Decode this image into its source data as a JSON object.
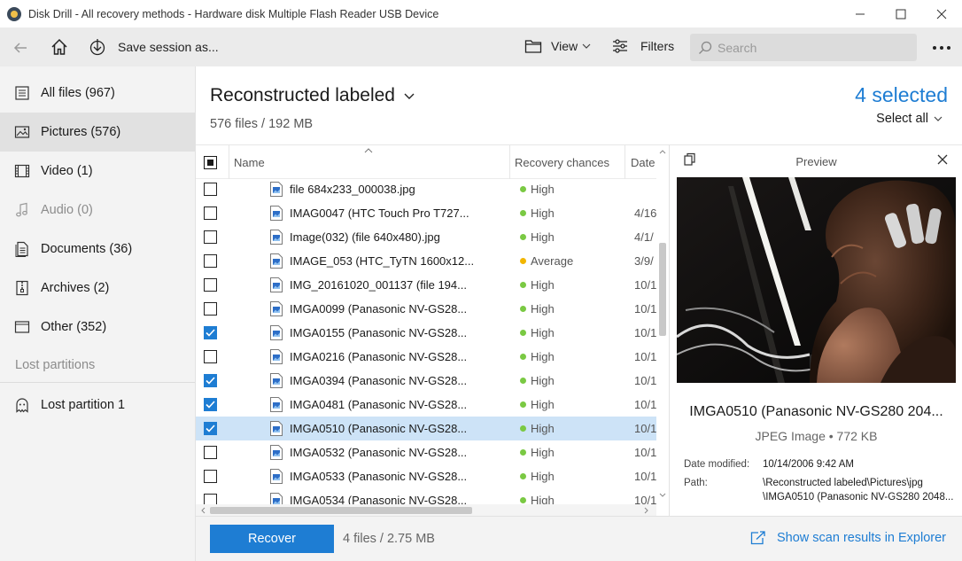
{
  "window": {
    "title": "Disk Drill - All recovery methods - Hardware disk Multiple Flash Reader USB Device"
  },
  "toolbar": {
    "save_session_label": "Save session as...",
    "view_label": "View",
    "filters_label": "Filters",
    "search_placeholder": "Search"
  },
  "sidebar": {
    "items": [
      {
        "label": "All files (967)",
        "icon": "all-files-icon"
      },
      {
        "label": "Pictures (576)",
        "icon": "picture-icon"
      },
      {
        "label": "Video (1)",
        "icon": "video-icon"
      },
      {
        "label": "Audio (0)",
        "icon": "music-icon"
      },
      {
        "label": "Documents (36)",
        "icon": "document-icon"
      },
      {
        "label": "Archives (2)",
        "icon": "archive-icon"
      },
      {
        "label": "Other (352)",
        "icon": "other-icon"
      }
    ],
    "lost_partitions_heading": "Lost partitions",
    "lost_partition_item": "Lost partition 1"
  },
  "main": {
    "title": "Reconstructed labeled",
    "subtitle": "576 files / 192 MB",
    "selected_count": "4 selected",
    "select_all_label": "Select all"
  },
  "table": {
    "columns": {
      "name": "Name",
      "chances": "Recovery chances",
      "date": "Date"
    },
    "rows": [
      {
        "name": "file 684x233_000038.jpg",
        "chance": "High",
        "date": "",
        "checked": false,
        "selected": false
      },
      {
        "name": "IMAG0047 (HTC Touch Pro T727...",
        "chance": "High",
        "date": "4/16",
        "checked": false,
        "selected": false
      },
      {
        "name": "Image(032) (file 640x480).jpg",
        "chance": "High",
        "date": "4/1/",
        "checked": false,
        "selected": false
      },
      {
        "name": "IMAGE_053 (HTC_TyTN 1600x12...",
        "chance": "Average",
        "date": "3/9/",
        "checked": false,
        "selected": false
      },
      {
        "name": "IMG_20161020_001137 (file 194...",
        "chance": "High",
        "date": "10/1",
        "checked": false,
        "selected": false
      },
      {
        "name": "IMGA0099 (Panasonic NV-GS28...",
        "chance": "High",
        "date": "10/1",
        "checked": false,
        "selected": false
      },
      {
        "name": "IMGA0155 (Panasonic NV-GS28...",
        "chance": "High",
        "date": "10/1",
        "checked": true,
        "selected": false
      },
      {
        "name": "IMGA0216 (Panasonic NV-GS28...",
        "chance": "High",
        "date": "10/1",
        "checked": false,
        "selected": false
      },
      {
        "name": "IMGA0394 (Panasonic NV-GS28...",
        "chance": "High",
        "date": "10/1",
        "checked": true,
        "selected": false
      },
      {
        "name": "IMGA0481 (Panasonic NV-GS28...",
        "chance": "High",
        "date": "10/1",
        "checked": true,
        "selected": false
      },
      {
        "name": "IMGA0510 (Panasonic NV-GS28...",
        "chance": "High",
        "date": "10/1",
        "checked": true,
        "selected": true
      },
      {
        "name": "IMGA0532 (Panasonic NV-GS28...",
        "chance": "High",
        "date": "10/1",
        "checked": false,
        "selected": false
      },
      {
        "name": "IMGA0533 (Panasonic NV-GS28...",
        "chance": "High",
        "date": "10/1",
        "checked": false,
        "selected": false
      },
      {
        "name": "IMGA0534 (Panasonic NV-GS28...",
        "chance": "High",
        "date": "10/1",
        "checked": false,
        "selected": false
      }
    ]
  },
  "colors": {
    "accent": "#1e7dd3",
    "chance_high": "#7ac943",
    "chance_average": "#f2b600",
    "selected_row": "#cde3f7"
  },
  "preview": {
    "title": "Preview",
    "file_name": "IMGA0510 (Panasonic NV-GS280 204...",
    "file_type": "JPEG Image • 772 KB",
    "date_label": "Date modified:",
    "date_value": "10/14/2006 9:42 AM",
    "path_label": "Path:",
    "path_line1": "\\Reconstructed labeled\\Pictures\\jpg",
    "path_line2": "\\IMGA0510 (Panasonic NV-GS280 2048..."
  },
  "footer": {
    "recover_label": "Recover",
    "info": "4 files / 2.75 MB",
    "explorer_link": "Show scan results in Explorer"
  }
}
